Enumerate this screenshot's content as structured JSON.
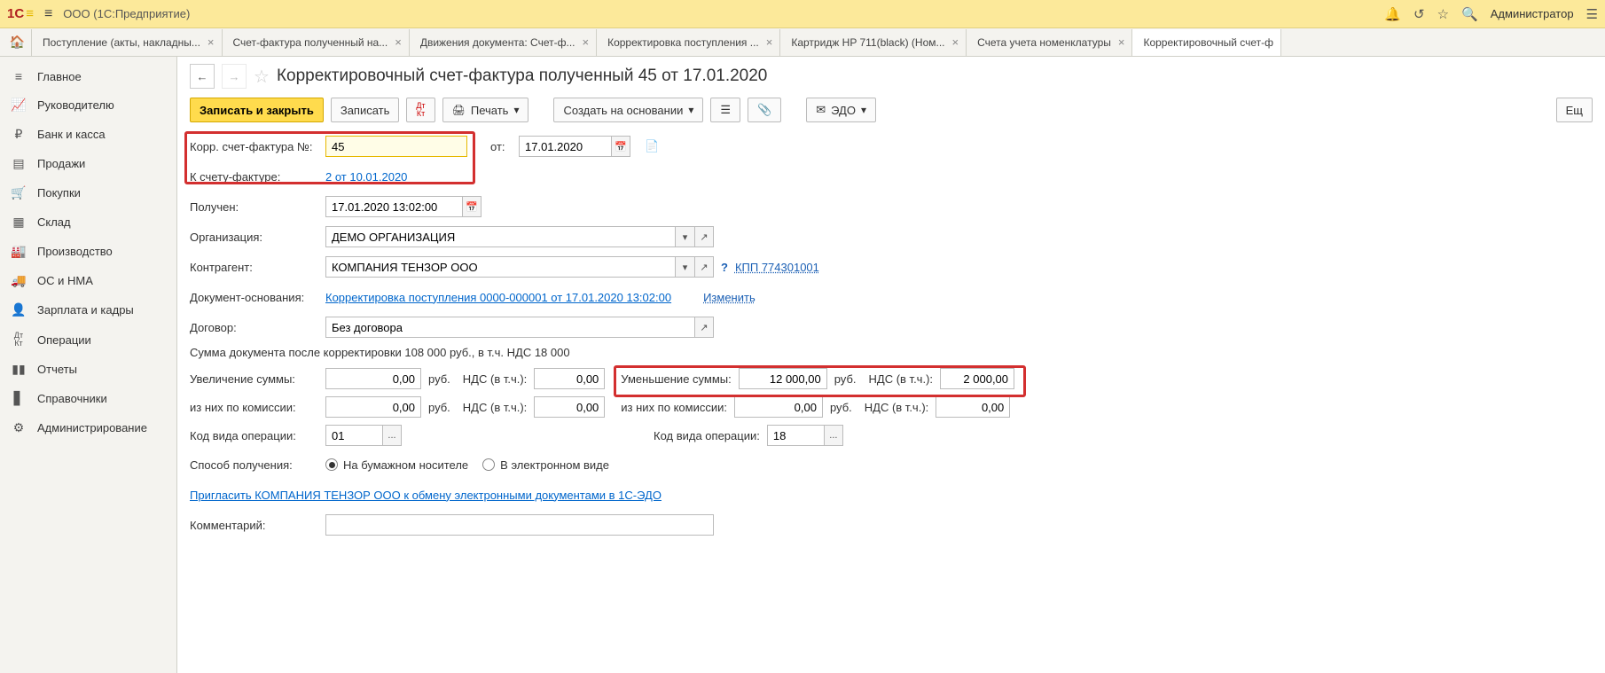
{
  "topbar": {
    "company": "ООО",
    "platform": "(1С:Предприятие)",
    "user": "Администратор"
  },
  "tabs": [
    {
      "label": "Поступление (акты, накладны..."
    },
    {
      "label": "Счет-фактура полученный на..."
    },
    {
      "label": "Движения документа: Счет-ф..."
    },
    {
      "label": "Корректировка поступления ..."
    },
    {
      "label": "Картридж HP 711(black) (Ном..."
    },
    {
      "label": "Счета учета номенклатуры"
    },
    {
      "label": "Корректировочный счет-ф"
    }
  ],
  "nav": [
    {
      "icon": "≡",
      "label": "Главное"
    },
    {
      "icon": "📈",
      "label": "Руководителю"
    },
    {
      "icon": "₽",
      "label": "Банк и касса"
    },
    {
      "icon": "📄",
      "label": "Продажи"
    },
    {
      "icon": "🛒",
      "label": "Покупки"
    },
    {
      "icon": "🏢",
      "label": "Склад"
    },
    {
      "icon": "🏭",
      "label": "Производство"
    },
    {
      "icon": "🚚",
      "label": "ОС и НМА"
    },
    {
      "icon": "👤",
      "label": "Зарплата и кадры"
    },
    {
      "icon": "Дт",
      "label": "Операции"
    },
    {
      "icon": "📊",
      "label": "Отчеты"
    },
    {
      "icon": "📚",
      "label": "Справочники"
    },
    {
      "icon": "⚙",
      "label": "Администрирование"
    }
  ],
  "page": {
    "title": "Корректировочный счет-фактура полученный 45 от 17.01.2020"
  },
  "toolbar": {
    "save_close": "Записать и закрыть",
    "save": "Записать",
    "print": "Печать",
    "create_based": "Создать на основании",
    "edo": "ЭДО",
    "more": "Ещ"
  },
  "form": {
    "number_label": "Корр. счет-фактура №:",
    "number_value": "45",
    "from_label": "от:",
    "date_value": "17.01.2020",
    "to_invoice_label": "К счету-фактуре:",
    "to_invoice_link": "2 от 10.01.2020",
    "received_label": "Получен:",
    "received_value": "17.01.2020 13:02:00",
    "org_label": "Организация:",
    "org_value": "ДЕМО ОРГАНИЗАЦИЯ",
    "counterparty_label": "Контрагент:",
    "counterparty_value": "КОМПАНИЯ ТЕНЗОР ООО",
    "kpp_link": "КПП 774301001",
    "basis_label": "Документ-основания:",
    "basis_link": "Корректировка поступления 0000-000001 от 17.01.2020 13:02:00",
    "change_link": "Изменить",
    "contract_label": "Договор:",
    "contract_value": "Без договора",
    "summary": "Сумма документа после корректировки 108 000 руб., в т.ч. НДС 18 000",
    "increase_label": "Увеличение суммы:",
    "increase_value": "0,00",
    "rub": "руб.",
    "vat_label": "НДС (в т.ч.):",
    "increase_vat": "0,00",
    "decrease_label": "Уменьшение суммы:",
    "decrease_value": "12 000,00",
    "decrease_vat": "2 000,00",
    "commission_label": "из них по комиссии:",
    "commission_inc": "0,00",
    "commission_inc_vat": "0,00",
    "commission_dec": "0,00",
    "commission_dec_vat": "0,00",
    "op_code_label": "Код вида операции:",
    "op_code_inc": "01",
    "op_code_dec": "18",
    "method_label": "Способ получения:",
    "radio_paper": "На бумажном носителе",
    "radio_electronic": "В электронном виде",
    "invite_link": "Пригласить КОМПАНИЯ ТЕНЗОР ООО к обмену электронными документами в 1С-ЭДО",
    "comment_label": "Комментарий:",
    "comment_value": ""
  }
}
